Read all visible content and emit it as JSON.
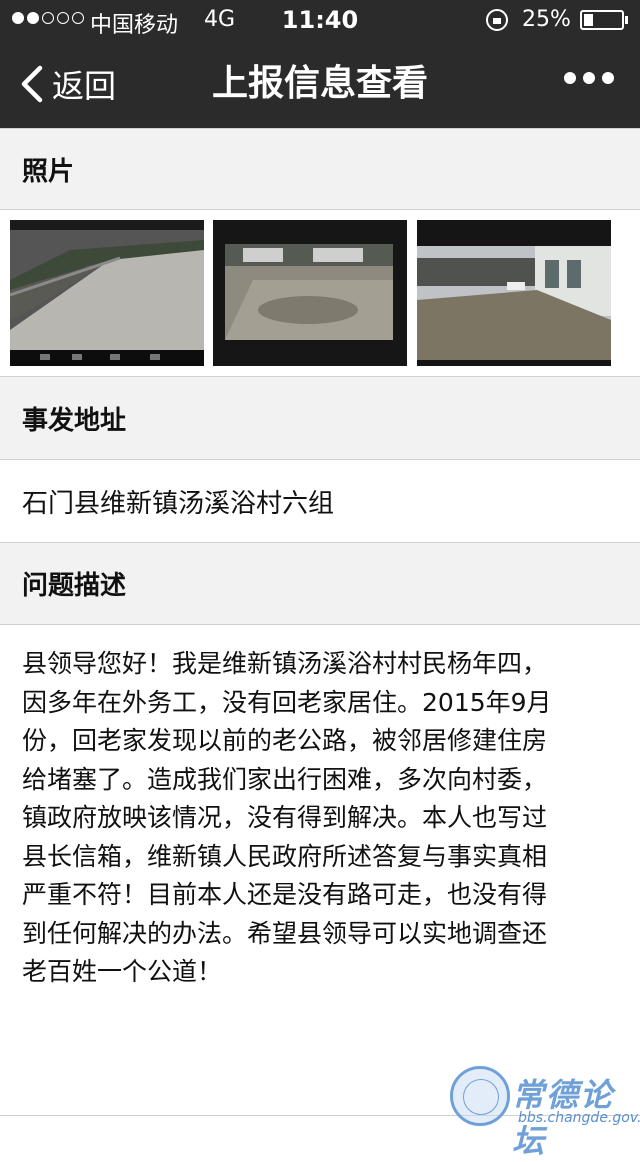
{
  "status_bar": {
    "carrier": "中国移动",
    "network": "4G",
    "time": "11:40",
    "battery_percent": "25%",
    "battery_level": 0.25,
    "signal_dots_filled": 2,
    "signal_dots_total": 5
  },
  "nav": {
    "back_label": "返回",
    "title": "上报信息查看",
    "more_icon": "more-dots-icon"
  },
  "sections": {
    "photos_header": "照片",
    "address_header": "事发地址",
    "address_value": "石门县维新镇汤溪浴村六组",
    "description_header": "问题描述",
    "description_lines": [
      "县领导您好！我是维新镇汤溪浴村村民杨年四，",
      "因多年在外务工，没有回老家居住。2015年9月",
      "份，回老家发现以前的老公路，被邻居修建住房",
      "给堵塞了。造成我们家出行困难，多次向村委，",
      "镇政府放映该情况，没有得到解决。本人也写过",
      "县长信箱，维新镇人民政府所述答复与事实真相",
      "严重不符！目前本人还是没有路可走，也没有得",
      "到任何解决的办法。希望县领导可以实地调查还",
      "老百姓一个公道！"
    ]
  },
  "photos": [
    {
      "label": "photo-road"
    },
    {
      "label": "photo-blocked-path"
    },
    {
      "label": "photo-houses"
    }
  ],
  "watermark": {
    "text": "常德论坛",
    "url": "bbs.changde.gov.cn"
  },
  "colors": {
    "topbar": "#2b2b2b",
    "section_bg": "#f2f2f2",
    "divider": "#d0d0d0",
    "watermark": "#6fa0d8"
  }
}
